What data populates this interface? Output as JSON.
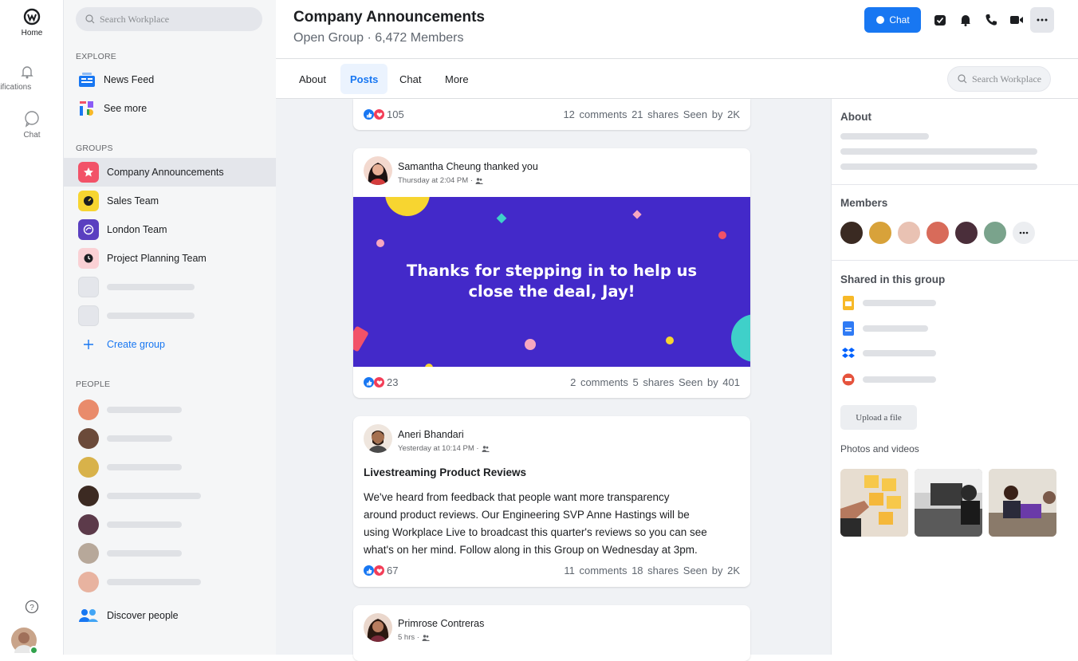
{
  "rail": {
    "home_label": "Home",
    "notifications_label": "otifications",
    "chat_label": "Chat"
  },
  "sidebar": {
    "search_placeholder": "Search Workplace",
    "explore_heading": "EXPLORE",
    "explore_items": [
      {
        "label": "News Feed",
        "icon": "news-feed-icon"
      },
      {
        "label": "See more",
        "icon": "see-more-icon"
      }
    ],
    "groups_heading": "GROUPS",
    "groups": [
      {
        "label": "Company Announcements",
        "color": "#f25268",
        "icon": "star-icon"
      },
      {
        "label": "Sales Team",
        "color": "#f7d530",
        "icon": "gauge-icon"
      },
      {
        "label": "London Team",
        "color": "#5a3fc0",
        "icon": "globe-icon"
      },
      {
        "label": "Project Planning Team",
        "color": "#fad1d5",
        "icon": "clock-icon"
      }
    ],
    "create_group_label": "Create group",
    "people_heading": "PEOPLE",
    "discover_people_label": "Discover people"
  },
  "header": {
    "title": "Company Announcements",
    "subtitle": "Open Group · 6,472 Members",
    "chat_button_label": "Chat",
    "tabs": [
      {
        "label": "About"
      },
      {
        "label": "Posts",
        "active": true
      },
      {
        "label": "Chat"
      },
      {
        "label": "More"
      }
    ],
    "search_placeholder": "Search Workplace"
  },
  "feed": {
    "post0": {
      "reactions": "105",
      "stats": "12 comments 21 shares Seen by 2K"
    },
    "post1": {
      "author": "Samantha Cheung thanked you",
      "meta": "Thursday at 2:04 PM ·",
      "banner_line1": "Thanks for stepping in to help us",
      "banner_line2": "close the deal, Jay!",
      "banner_color": "#4329c9",
      "reactions": "23",
      "stats": "2 comments 5 shares Seen by 401"
    },
    "post2": {
      "author": "Aneri Bhandari",
      "meta": "Yesterday at 10:14 PM ·",
      "title": "Livestreaming Product Reviews",
      "body_lines": [
        "We've heard from feedback that people want more transparency",
        "around product reviews. Our Engineering SVP Anne Hastings will be",
        "using Workplace Live to broadcast this quarter's reviews so you can see",
        "what's on her mind. Follow along in this Group on Wednesday at 3pm."
      ],
      "reactions": "67",
      "stats": "11 comments 18 shares Seen by 2K"
    },
    "post3": {
      "author": "Primrose Contreras",
      "meta": "5 hrs ·"
    }
  },
  "right_panel": {
    "about_heading": "About",
    "members_heading": "Members",
    "shared_heading": "Shared in this group",
    "upload_label": "Upload a file",
    "photos_heading": "Photos and videos"
  },
  "colors": {
    "accent": "#1877f2",
    "like": "#1877f2",
    "love": "#f33e58"
  }
}
